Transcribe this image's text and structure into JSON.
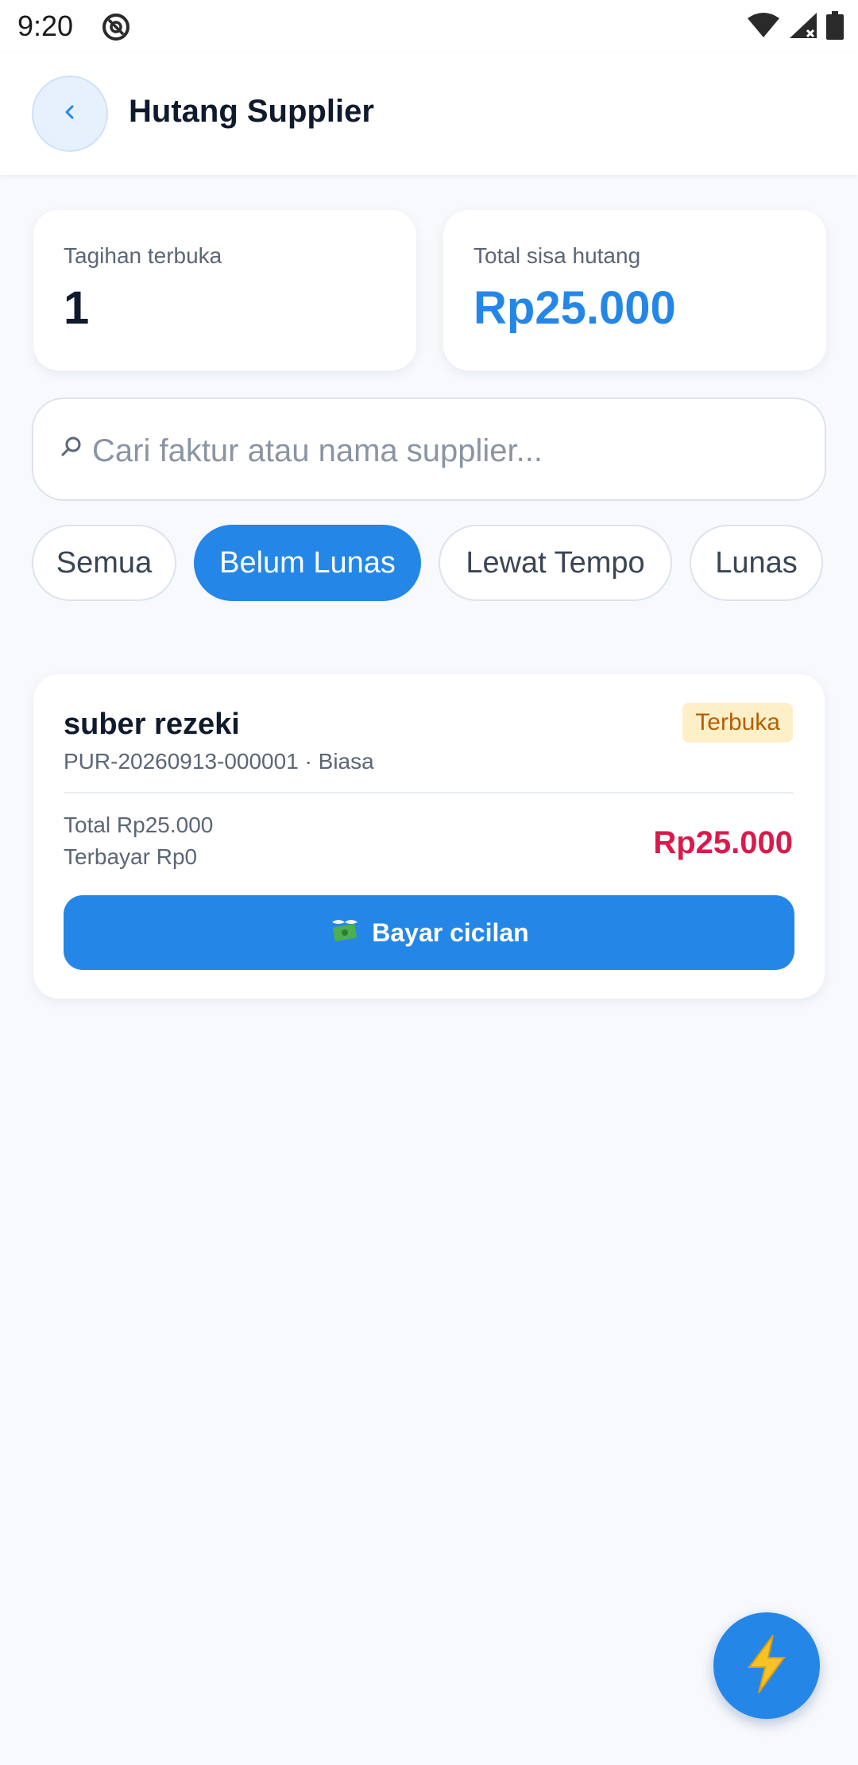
{
  "status_bar": {
    "time": "9:20",
    "icons": [
      "do-not-disturb-icon",
      "wifi-icon",
      "signal-icon",
      "battery-icon"
    ]
  },
  "header": {
    "back_icon": "chevron-left-icon",
    "title": "Hutang Supplier"
  },
  "summary": {
    "open_bills_label": "Tagihan terbuka",
    "open_bills_value": "1",
    "total_debt_label": "Total sisa hutang",
    "total_debt_value": "Rp25.000"
  },
  "search": {
    "icon": "search-icon",
    "placeholder": "Cari faktur atau nama supplier...",
    "value": ""
  },
  "filters": [
    {
      "label": "Semua",
      "active": false
    },
    {
      "label": "Belum Lunas",
      "active": true
    },
    {
      "label": "Lewat Tempo",
      "active": false
    },
    {
      "label": "Lunas",
      "active": false
    }
  ],
  "invoices": [
    {
      "supplier": "suber rezeki",
      "reference": "PUR-20260913-000001 · Biasa",
      "status": "Terbuka",
      "total": "Total Rp25.000",
      "paid": "Terbayar Rp0",
      "remaining": "Rp25.000",
      "pay_icon": "money-with-wings-icon",
      "pay_label": "Bayar cicilan"
    }
  ],
  "fab": {
    "icon": "lightning-icon"
  },
  "colors": {
    "accent": "#2487e8",
    "danger": "#d81b4c",
    "badge_bg": "#fdf0c8",
    "badge_text": "#b45f06",
    "background": "#f7f9fc"
  }
}
